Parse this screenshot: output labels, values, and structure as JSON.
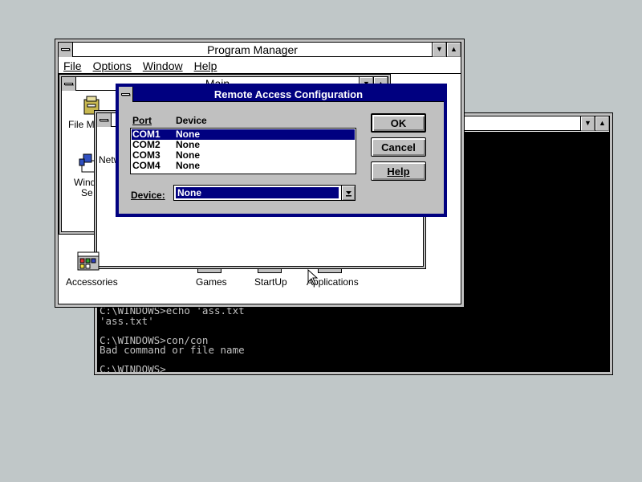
{
  "dos_window": {
    "lines": [
      "C:\\WINDOWS>echo 'ass.txt",
      "'ass.txt'",
      "",
      "C:\\WINDOWS>con/con",
      "Bad command or file name",
      "",
      "C:\\WINDOWS>"
    ]
  },
  "program_manager": {
    "title": "Program Manager",
    "menu": [
      "File",
      "Options",
      "Window",
      "Help"
    ],
    "main_group_title": "Main",
    "icons": {
      "file_manager": "File Ma",
      "network": "Netw",
      "windows_setup_line1": "Windo",
      "windows_setup_line2": "Se"
    },
    "group_icons": [
      "Accessories",
      "Games",
      "StartUp",
      "Applications"
    ]
  },
  "dialog": {
    "title": "Remote Access Configuration",
    "port_header": "Port",
    "device_header": "Device",
    "rows": [
      {
        "port": "COM1",
        "device": "None"
      },
      {
        "port": "COM2",
        "device": "None"
      },
      {
        "port": "COM3",
        "device": "None"
      },
      {
        "port": "COM4",
        "device": "None"
      }
    ],
    "device_label": "Device:",
    "device_value": "None",
    "ok_label": "OK",
    "cancel_label": "Cancel",
    "help_label": "Help"
  }
}
